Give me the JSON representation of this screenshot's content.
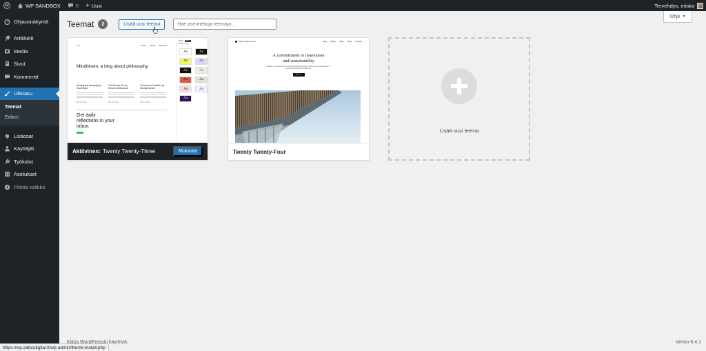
{
  "adminbar": {
    "site_name": "WP SANDBOX",
    "comments_count": "0",
    "new_label": "Uusi",
    "greeting": "Tervehdys, miska"
  },
  "sidebar": {
    "items": [
      {
        "label": "Ohjausnäkymä",
        "icon": "dashboard-icon"
      },
      {
        "label": "Artikkelit",
        "icon": "pin-icon"
      },
      {
        "label": "Media",
        "icon": "media-icon"
      },
      {
        "label": "Sivut",
        "icon": "pages-icon"
      },
      {
        "label": "Kommentit",
        "icon": "comments-icon"
      },
      {
        "label": "Ulkoasu",
        "icon": "brush-icon"
      },
      {
        "label": "Lisäosat",
        "icon": "plugin-icon"
      },
      {
        "label": "Käyttäjät",
        "icon": "users-icon"
      },
      {
        "label": "Työkalut",
        "icon": "tools-icon"
      },
      {
        "label": "Asetukset",
        "icon": "settings-icon"
      }
    ],
    "submenu": [
      {
        "label": "Teemat"
      },
      {
        "label": "Editori"
      }
    ],
    "collapse_label": "Piilota valikko"
  },
  "help_tab": "Ohje",
  "page": {
    "title": "Teemat",
    "count": "2",
    "add_button": "Lisää uusi teema",
    "search_placeholder": "Hae asennettuja teemoja..."
  },
  "themes": {
    "active": {
      "active_prefix": "Aktiivinen:",
      "name": "Twenty Twenty-Three",
      "customize": "Mukauta",
      "preview": {
        "nav_brand": "Tt3",
        "nav_links": [
          "About",
          "Books",
          "All Posts"
        ],
        "headline": "Mindblown: a blog about philosophy.",
        "posts": [
          {
            "title": "Naming and Necessity by Saul Kripke",
            "date": "Mar 16, 2023"
          },
          {
            "title": "The Second Sex by Simone de Beauvoir",
            "date": "Mar 16, 2023"
          },
          {
            "title": "The Human Condition by Hannah Arendt",
            "date": "Mar 16, 2023"
          }
        ],
        "daily": "Get daily reflections in your inbox.",
        "panel_tabs": [
          "Styles",
          "Blocks"
        ],
        "panel_heading": "Browse styles",
        "swatch_text": "Aa"
      }
    },
    "second": {
      "name": "Twenty Twenty-Four",
      "preview": {
        "nav_brand": "Twenty Twenty-Four",
        "nav_links": [
          "Blog",
          "Pages",
          "Team",
          "Shop",
          "Contact"
        ],
        "headline_1": "A commitment to innovation",
        "headline_2": "and sustainability",
        "body": "Études is a pioneering firm that seamlessly merges creativity and functionality to redefine architectural excellence.",
        "button": "About us"
      }
    },
    "add_new": {
      "label": "Lisää uusi teema"
    }
  },
  "footer": {
    "left": "Kiitos WordPressin käytöstä.",
    "version": "Versio 6.4.1"
  },
  "statusbar": "https://wp.aatosdigital.fi/wp-admin/theme-install.php",
  "colors": {
    "admin_dark": "#1d2327",
    "accent": "#2271b1",
    "background": "#f0f0f1"
  }
}
